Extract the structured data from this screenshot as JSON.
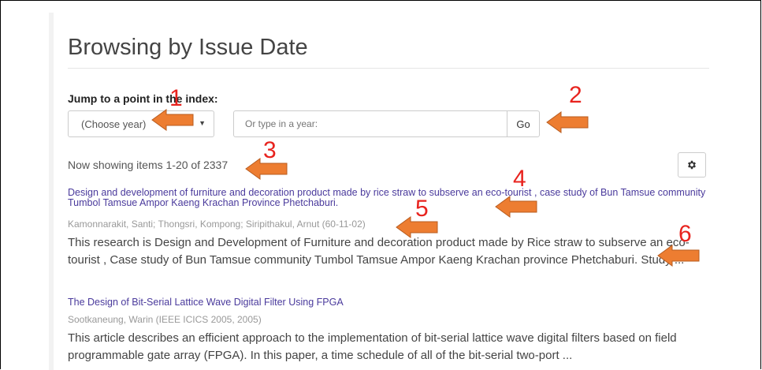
{
  "page": {
    "title": "Browsing by Issue Date"
  },
  "jump": {
    "label": "Jump to a point in the index:",
    "year_select_value": "(Choose year)",
    "year_input_placeholder": "Or type in a year:",
    "go_label": "Go"
  },
  "results": {
    "showing_text": "Now showing items 1-20 of 2337"
  },
  "items": [
    {
      "title": "Design and development of furniture and decoration product made by rice straw to subserve an eco-tourist , case study of Bun Tamsue community Tumbol Tamsue Ampor Kaeng Krachan Province Phetchaburi.",
      "meta": "Kamonnarakit, Santi; Thongsri, Kompong; Siripithakul, Arnut (60-11-02)",
      "abstract": "This research is Design and Development of Furniture and decoration product made by Rice straw to subserve an eco-tourist , Case study of Bun Tamsue community Tumbol Tamsue Ampor Kaeng Krachan province Phetchaburi. Study ..."
    },
    {
      "title": "The Design of Bit-Serial Lattice Wave Digital Filter Using FPGA",
      "meta": "Sootkaneung, Warin (IEEE ICICS 2005, 2005)",
      "abstract": "This article describes an efficient approach to the implementation of bit-serial lattice wave digital filters based on field programmable gate array (FPGA). In this paper, a time schedule of all of the bit-serial two-port ..."
    }
  ],
  "annotations": {
    "labels": [
      "1",
      "2",
      "3",
      "4",
      "5",
      "6"
    ],
    "arrow_color": "#ed7d31",
    "number_color": "#e8231e"
  },
  "icons": {
    "settings": "gear-icon",
    "dropdown": "caret-down-icon"
  }
}
